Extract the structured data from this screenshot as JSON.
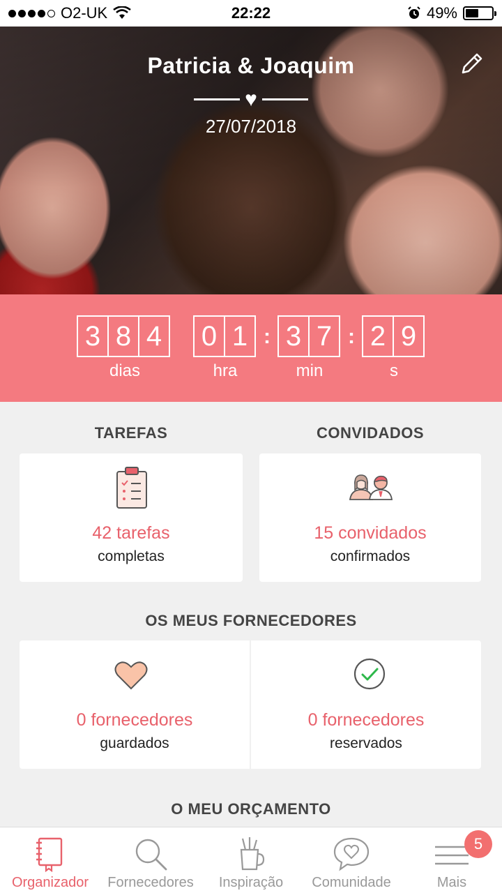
{
  "status_bar": {
    "carrier": "O2-UK",
    "time": "22:22",
    "battery_percent": "49%",
    "battery_level": 0.49
  },
  "hero": {
    "couple_names": "Patricia & Joaquim",
    "wedding_date": "27/07/2018"
  },
  "countdown": {
    "days": [
      "3",
      "8",
      "4"
    ],
    "hours": [
      "0",
      "1"
    ],
    "minutes": [
      "3",
      "7"
    ],
    "seconds": [
      "2",
      "9"
    ],
    "separator": ":",
    "labels": {
      "days": "dias",
      "hours": "hra",
      "minutes": "min",
      "seconds": "s"
    }
  },
  "tasks": {
    "title": "TAREFAS",
    "value": "42 tarefas",
    "sub": "completas"
  },
  "guests": {
    "title": "CONVIDADOS",
    "value": "15 convidados",
    "sub": "confirmados"
  },
  "suppliers": {
    "title": "OS MEUS FORNECEDORES",
    "saved": {
      "value": "0 fornecedores",
      "sub": "guardados"
    },
    "booked": {
      "value": "0 fornecedores",
      "sub": "reservados"
    }
  },
  "budget": {
    "title": "O MEU ORÇAMENTO"
  },
  "nav": {
    "items": [
      {
        "label": "Organizador",
        "icon": "notebook-icon"
      },
      {
        "label": "Fornecedores",
        "icon": "search-icon"
      },
      {
        "label": "Inspiração",
        "icon": "pencil-cup-icon"
      },
      {
        "label": "Comunidade",
        "icon": "chat-heart-icon"
      },
      {
        "label": "Mais",
        "icon": "menu-icon"
      }
    ],
    "badge_count": "5"
  },
  "colors": {
    "accent": "#f47a80",
    "accent_text": "#e8616b",
    "background": "#f0f0f0"
  }
}
